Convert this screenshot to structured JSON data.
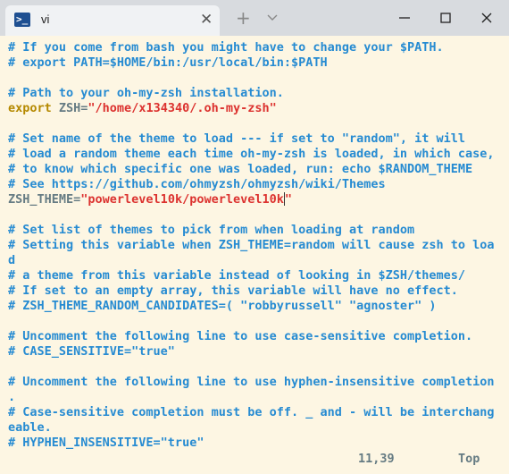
{
  "window": {
    "tab_title": "vi",
    "tab_icon": "terminal-icon",
    "tab_close_glyph": "✕",
    "new_tab_glyph": "+",
    "controls": [
      "minimize-icon",
      "maximize-icon",
      "close-icon"
    ]
  },
  "colors": {
    "background": "#fdf6e3",
    "comment": "#268bd2",
    "keyword": "#b58900",
    "string": "#dc322f",
    "plain": "#657b83"
  },
  "editor": {
    "lines": {
      "l1": "# If you come from bash you might have to change your $PATH.",
      "l2": "# export PATH=$HOME/bin:/usr/local/bin:$PATH",
      "l3": "# Path to your oh-my-zsh installation.",
      "l4_keyword": "export",
      "l4_plain": " ZSH=",
      "l4_string": "\"/home/x134340/.oh-my-zsh\"",
      "l5": "# Set name of the theme to load --- if set to \"random\", it will",
      "l6": "# load a random theme each time oh-my-zsh is loaded, in which case,",
      "l7": "# to know which specific one was loaded, run: echo $RANDOM_THEME",
      "l8": "# See https://github.com/ohmyzsh/ohmyzsh/wiki/Themes",
      "l9_plain": "ZSH_THEME=",
      "l9_string": "\"powerlevel10k/powerlevel10k",
      "l9_string_end": "\"",
      "l10": "# Set list of themes to pick from when loading at random",
      "l11a": "# Setting this variable when ZSH_THEME=random will cause zsh to loa",
      "l11b": "d",
      "l12": "# a theme from this variable instead of looking in $ZSH/themes/",
      "l13": "# If set to an empty array, this variable will have no effect.",
      "l14": "# ZSH_THEME_RANDOM_CANDIDATES=( \"robbyrussell\" \"agnoster\" )",
      "l15": "# Uncomment the following line to use case-sensitive completion.",
      "l16": "# CASE_SENSITIVE=\"true\"",
      "l17a": "# Uncomment the following line to use hyphen-insensitive completion",
      "l17b": ".",
      "l18a": "# Case-sensitive completion must be off. _ and - will be interchang",
      "l18b": "eable.",
      "l19": "# HYPHEN_INSENSITIVE=\"true\""
    }
  },
  "status": {
    "position": "11,39",
    "scroll": "Top"
  }
}
